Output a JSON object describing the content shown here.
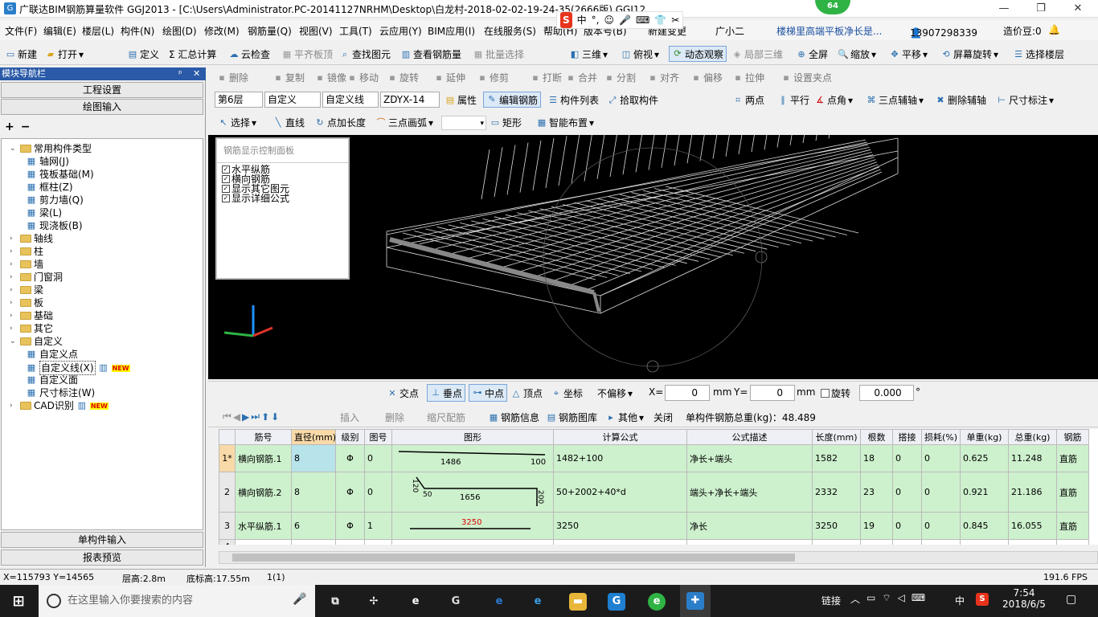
{
  "window": {
    "title": "广联达BIM钢筋算量软件 GGJ2013 - [C:\\Users\\Administrator.PC-20141127NRHM\\Desktop\\白龙村-2018-02-02-19-24-35(2666版).GGJ12]",
    "minimize": "—",
    "maximize": "❐",
    "close": "✕"
  },
  "ime": {
    "logo": "S",
    "items": [
      "中",
      "°,",
      "☺",
      "🎤",
      "⌨",
      "👕",
      "✂"
    ]
  },
  "badge": "64",
  "menu": [
    "文件(F)",
    "编辑(E)",
    "楼层(L)",
    "构件(N)",
    "绘图(D)",
    "修改(M)",
    "钢筋量(Q)",
    "视图(V)",
    "工具(T)",
    "云应用(Y)",
    "BIM应用(I)",
    "在线服务(S)",
    "帮助(H)",
    "版本号(B)",
    "新建变更",
    "广小二"
  ],
  "menu_right": {
    "question": "楼梯里高端平板净长是...",
    "phone": "13907298339",
    "zaojia": "造价豆:0"
  },
  "toolbar1": [
    "新建",
    "打开",
    "定义",
    "Σ 汇总计算",
    "云检查",
    "平齐板顶",
    "查找图元",
    "查看钢筋量",
    "批量选择",
    "三维",
    "俯视",
    "动态观察",
    "局部三维",
    "全屏",
    "缩放",
    "平移",
    "屏幕旋转",
    "选择楼层"
  ],
  "toolbar2": [
    "删除",
    "复制",
    "镜像",
    "移动",
    "旋转",
    "延伸",
    "修剪",
    "打断",
    "合并",
    "分割",
    "对齐",
    "偏移",
    "拉伸",
    "设置夹点"
  ],
  "toolbar3": {
    "floor": "第6层",
    "type": "自定义",
    "subtype": "自定义线",
    "code": "ZDYX-14",
    "buttons": [
      "属性",
      "编辑钢筋",
      "构件列表",
      "拾取构件"
    ],
    "right": [
      "两点",
      "平行",
      "点角",
      "三点辅轴",
      "删除辅轴",
      "尺寸标注"
    ]
  },
  "toolbar4": [
    "选择",
    "直线",
    "点加长度",
    "三点画弧",
    "矩形",
    "智能布置"
  ],
  "leftpanel": {
    "header": "模块导航栏",
    "pin": "ᵖ",
    "close": "✕",
    "btn_top1": "工程设置",
    "btn_top2": "绘图输入",
    "btn_bot1": "单构件输入",
    "btn_bot2": "报表预览",
    "expand_all": "+",
    "collapse_all": "−"
  },
  "tree": [
    {
      "label": "常用构件类型",
      "level": 0,
      "expanded": true,
      "folder": true
    },
    {
      "label": "轴网(J)",
      "level": 1,
      "icon": "grid-icon"
    },
    {
      "label": "筏板基础(M)",
      "level": 1,
      "icon": "raft-icon"
    },
    {
      "label": "框柱(Z)",
      "level": 1,
      "icon": "column-icon"
    },
    {
      "label": "剪力墙(Q)",
      "level": 1,
      "icon": "wall-icon"
    },
    {
      "label": "梁(L)",
      "level": 1,
      "icon": "beam-icon"
    },
    {
      "label": "现浇板(B)",
      "level": 1,
      "icon": "slab-icon"
    },
    {
      "label": "轴线",
      "level": 0,
      "folder": true
    },
    {
      "label": "柱",
      "level": 0,
      "folder": true
    },
    {
      "label": "墙",
      "level": 0,
      "folder": true
    },
    {
      "label": "门窗洞",
      "level": 0,
      "folder": true
    },
    {
      "label": "梁",
      "level": 0,
      "folder": true
    },
    {
      "label": "板",
      "level": 0,
      "folder": true
    },
    {
      "label": "基础",
      "level": 0,
      "folder": true
    },
    {
      "label": "其它",
      "level": 0,
      "folder": true
    },
    {
      "label": "自定义",
      "level": 0,
      "expanded": true,
      "folder": true
    },
    {
      "label": "自定义点",
      "level": 1,
      "icon": "point-icon"
    },
    {
      "label": "自定义线(X)",
      "level": 1,
      "icon": "line-icon",
      "new": "NEW",
      "selected": true
    },
    {
      "label": "自定义面",
      "level": 1,
      "icon": "face-icon"
    },
    {
      "label": "尺寸标注(W)",
      "level": 1,
      "icon": "dim-icon"
    },
    {
      "label": "CAD识别",
      "level": 0,
      "folder": true,
      "new": "NEW"
    }
  ],
  "rebar_panel": {
    "title": "钢筋显示控制面板",
    "items": [
      "水平纵筋",
      "横向钢筋",
      "显示其它图元",
      "显示详细公式"
    ],
    "checked": "✓"
  },
  "snapbar": {
    "items": [
      "交点",
      "垂点",
      "中点",
      "顶点",
      "坐标"
    ],
    "offset": "不偏移",
    "x_label": "X=",
    "x_val": "0",
    "y_label": "Y=",
    "y_val": "0",
    "unit": "mm",
    "rotate": "旋转",
    "rot_val": "0.000",
    "deg": "°"
  },
  "tablebar": {
    "items": [
      "插入",
      "删除",
      "缩尺配筋",
      "钢筋信息",
      "钢筋图库",
      "其他",
      "关闭"
    ],
    "total": "单构件钢筋总重(kg)：48.489"
  },
  "table": {
    "headers": [
      "",
      "筋号",
      "直径(mm)",
      "级别",
      "图号",
      "图形",
      "计算公式",
      "公式描述",
      "长度(mm)",
      "根数",
      "搭接",
      "损耗(%)",
      "单重(kg)",
      "总重(kg)",
      "钢筋"
    ],
    "rows": [
      {
        "n": "1*",
        "name": "横向钢筋.1",
        "d": "8",
        "lvl": "Φ",
        "fig": "0",
        "shape_a": "1486",
        "shape_b": "100",
        "formula": "1482+100",
        "desc": "净长+端头",
        "len": "1582",
        "count": "18",
        "lap": "0",
        "loss": "0",
        "unit": "0.625",
        "total": "11.248",
        "type": "直筋"
      },
      {
        "n": "2",
        "name": "横向钢筋.2",
        "d": "8",
        "lvl": "Φ",
        "fig": "0",
        "shape_a": "1656",
        "shape_b": "50",
        "shape_c": "200",
        "shape_d": "120",
        "shape_e": "50",
        "formula": "50+2002+40*d",
        "desc": "端头+净长+端头",
        "len": "2332",
        "count": "23",
        "lap": "0",
        "loss": "0",
        "unit": "0.921",
        "total": "21.186",
        "type": "直筋"
      },
      {
        "n": "3",
        "name": "水平纵筋.1",
        "d": "6",
        "lvl": "Φ",
        "fig": "1",
        "shape_a": "3250",
        "formula": "3250",
        "desc": "净长",
        "len": "3250",
        "count": "19",
        "lap": "0",
        "loss": "0",
        "unit": "0.845",
        "total": "16.055",
        "type": "直筋"
      },
      {
        "n": "4"
      }
    ]
  },
  "status": {
    "coords": "X=115793 Y=14565",
    "floor_h": "层高:2.8m",
    "base_h": "底标高:17.55m",
    "sel": "1(1)",
    "fps": "191.6 FPS"
  },
  "taskbar": {
    "search": "在这里输入你要搜索的内容",
    "link": "链接",
    "lang": "中",
    "time": "7:54",
    "date": "2018/6/5"
  },
  "colors": {
    "accent": "#2a5aa8",
    "row_green": "#cdf0cd",
    "canvas": "#000000"
  }
}
